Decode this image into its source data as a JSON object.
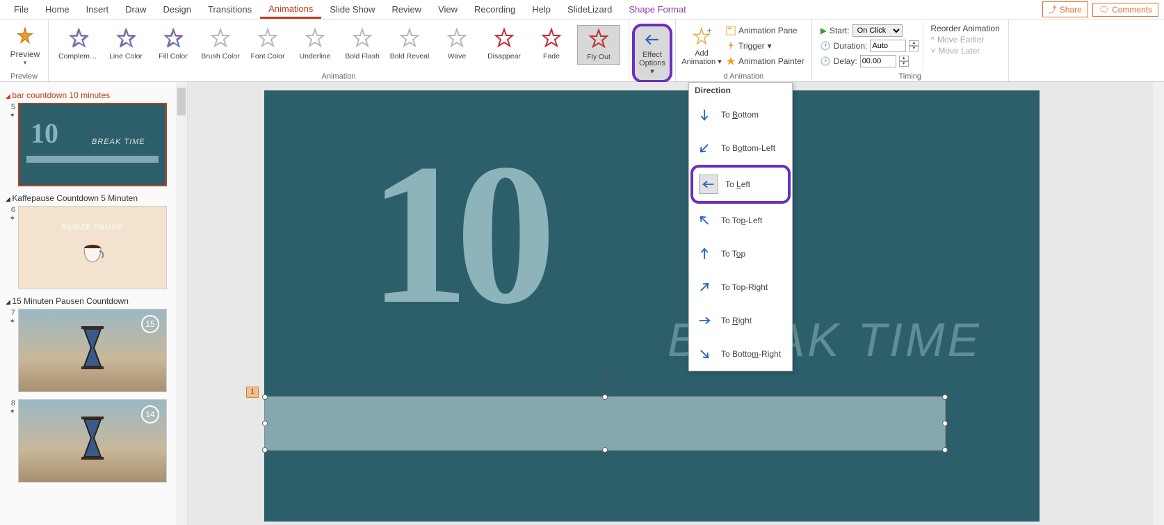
{
  "tabs": [
    "File",
    "Home",
    "Insert",
    "Draw",
    "Design",
    "Transitions",
    "Animations",
    "Slide Show",
    "Review",
    "View",
    "Recording",
    "Help",
    "SlideLizard",
    "Shape Format"
  ],
  "active_tab": "Animations",
  "share": "Share",
  "comments": "Comments",
  "ribbon": {
    "preview": {
      "label": "Preview",
      "group": "Preview"
    },
    "gallery": [
      {
        "label": "Compleme...",
        "type": "emph"
      },
      {
        "label": "Line Color",
        "type": "emph"
      },
      {
        "label": "Fill Color",
        "type": "emph"
      },
      {
        "label": "Brush Color",
        "type": "gray"
      },
      {
        "label": "Font Color",
        "type": "gray"
      },
      {
        "label": "Underline",
        "type": "gray"
      },
      {
        "label": "Bold Flash",
        "type": "gray"
      },
      {
        "label": "Bold Reveal",
        "type": "gray"
      },
      {
        "label": "Wave",
        "type": "gray"
      },
      {
        "label": "Disappear",
        "type": "exit"
      },
      {
        "label": "Fade",
        "type": "exit"
      },
      {
        "label": "Fly Out",
        "type": "exit",
        "selected": true
      }
    ],
    "animation_group": "Animation",
    "effect_options": {
      "l1": "Effect",
      "l2": "Options"
    },
    "add_animation": {
      "l1": "Add",
      "l2": "Animation"
    },
    "adv_cmds": {
      "pane": "Animation Pane",
      "trigger": "Trigger",
      "painter": "Animation Painter",
      "group": "d Animation"
    },
    "timing": {
      "start_lbl": "Start:",
      "start_val": "On Click",
      "dur_lbl": "Duration:",
      "dur_val": "Auto",
      "delay_lbl": "Delay:",
      "delay_val": "00.00",
      "group": "Timing"
    },
    "reorder": {
      "hd": "Reorder Animation",
      "earlier": "Move Earlier",
      "later": "Move Later"
    }
  },
  "sections": {
    "s1": "bar countdown 10 minutes",
    "s2": "Kaffepause Countdown 5 Minuten",
    "s3": "15 Minuten Pausen Countdown"
  },
  "thumbs": {
    "t1": {
      "num": "5",
      "big": "10",
      "sub": "BREAK TIME"
    },
    "t2": {
      "num": "6",
      "kp": "KURZE PAUSE"
    },
    "t3": {
      "num": "7",
      "badge": "15"
    },
    "t4": {
      "num": "8",
      "badge": "14"
    }
  },
  "slide": {
    "big": "10",
    "break": "BREAK TIME",
    "tag": "1"
  },
  "dir_menu": {
    "hdr": "Direction",
    "items": [
      {
        "pre": "To ",
        "u": "B",
        "post": "ottom",
        "rot": 90
      },
      {
        "pre": "To B",
        "u": "o",
        "post": "ttom-Left",
        "rot": 135
      },
      {
        "pre": "To ",
        "u": "L",
        "post": "eft",
        "rot": 180,
        "hl": true
      },
      {
        "pre": "To To",
        "u": "p",
        "post": "-Left",
        "rot": 225
      },
      {
        "pre": "To T",
        "u": "o",
        "post": "p",
        "rot": 270
      },
      {
        "pre": "To Top-Ri",
        "u": "g",
        "post": "ht",
        "rot": 315
      },
      {
        "pre": "To ",
        "u": "R",
        "post": "ight",
        "rot": 0
      },
      {
        "pre": "To Botto",
        "u": "m",
        "post": "-Right",
        "rot": 45
      }
    ]
  }
}
